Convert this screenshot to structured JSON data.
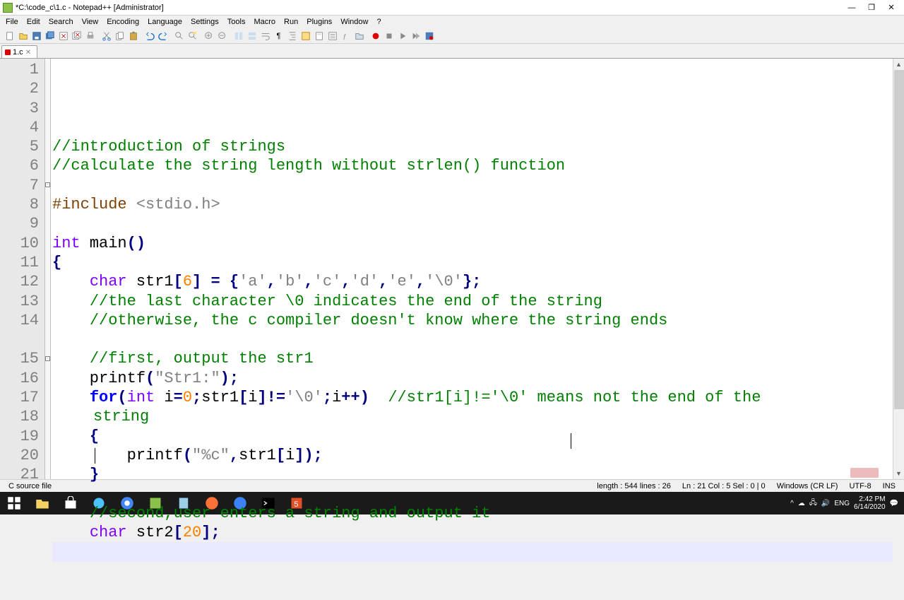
{
  "window": {
    "title": "*C:\\code_c\\1.c - Notepad++ [Administrator]"
  },
  "menu": [
    "File",
    "Edit",
    "Search",
    "View",
    "Encoding",
    "Language",
    "Settings",
    "Tools",
    "Macro",
    "Run",
    "Plugins",
    "Window",
    "?"
  ],
  "tab": {
    "label": "1.c"
  },
  "code": {
    "lines": [
      {
        "n": 1,
        "seg": [
          {
            "c": "cm",
            "t": "//introduction of strings"
          }
        ]
      },
      {
        "n": 2,
        "seg": [
          {
            "c": "cm",
            "t": "//calculate the string length without strlen() function"
          }
        ]
      },
      {
        "n": 3,
        "seg": []
      },
      {
        "n": 4,
        "seg": [
          {
            "c": "pp",
            "t": "#include "
          },
          {
            "c": "st",
            "t": "<stdio.h>"
          }
        ]
      },
      {
        "n": 5,
        "seg": []
      },
      {
        "n": 6,
        "seg": [
          {
            "c": "ty",
            "t": "int"
          },
          {
            "c": "",
            "t": " main"
          },
          {
            "c": "op",
            "t": "()"
          }
        ]
      },
      {
        "n": 7,
        "seg": [
          {
            "c": "op",
            "t": "{"
          }
        ],
        "fold": "-"
      },
      {
        "n": 8,
        "seg": [
          {
            "c": "",
            "t": "    "
          },
          {
            "c": "ty",
            "t": "char"
          },
          {
            "c": "",
            "t": " str1"
          },
          {
            "c": "op",
            "t": "["
          },
          {
            "c": "nu",
            "t": "6"
          },
          {
            "c": "op",
            "t": "]"
          },
          {
            "c": "",
            "t": " "
          },
          {
            "c": "op",
            "t": "="
          },
          {
            "c": "",
            "t": " "
          },
          {
            "c": "op",
            "t": "{"
          },
          {
            "c": "st",
            "t": "'a'"
          },
          {
            "c": "op",
            "t": ","
          },
          {
            "c": "st",
            "t": "'b'"
          },
          {
            "c": "op",
            "t": ","
          },
          {
            "c": "st",
            "t": "'c'"
          },
          {
            "c": "op",
            "t": ","
          },
          {
            "c": "st",
            "t": "'d'"
          },
          {
            "c": "op",
            "t": ","
          },
          {
            "c": "st",
            "t": "'e'"
          },
          {
            "c": "op",
            "t": ","
          },
          {
            "c": "st",
            "t": "'\\0'"
          },
          {
            "c": "op",
            "t": "};"
          }
        ]
      },
      {
        "n": 9,
        "seg": [
          {
            "c": "",
            "t": "    "
          },
          {
            "c": "cm",
            "t": "//the last character \\0 indicates the end of the string"
          }
        ]
      },
      {
        "n": 10,
        "seg": [
          {
            "c": "",
            "t": "    "
          },
          {
            "c": "cm",
            "t": "//otherwise, the c compiler doesn't know where the string ends"
          }
        ]
      },
      {
        "n": 11,
        "seg": []
      },
      {
        "n": 12,
        "seg": [
          {
            "c": "",
            "t": "    "
          },
          {
            "c": "cm",
            "t": "//first, output the str1"
          }
        ]
      },
      {
        "n": 13,
        "seg": [
          {
            "c": "",
            "t": "    printf"
          },
          {
            "c": "op",
            "t": "("
          },
          {
            "c": "st",
            "t": "\"Str1:\""
          },
          {
            "c": "op",
            "t": ");"
          }
        ]
      },
      {
        "n": 14,
        "seg": [
          {
            "c": "",
            "t": "    "
          },
          {
            "c": "kw",
            "t": "for"
          },
          {
            "c": "op",
            "t": "("
          },
          {
            "c": "ty",
            "t": "int"
          },
          {
            "c": "",
            "t": " i"
          },
          {
            "c": "op",
            "t": "="
          },
          {
            "c": "nu",
            "t": "0"
          },
          {
            "c": "op",
            "t": ";"
          },
          {
            "c": "",
            "t": "str1"
          },
          {
            "c": "op",
            "t": "["
          },
          {
            "c": "",
            "t": "i"
          },
          {
            "c": "op",
            "t": "]!="
          },
          {
            "c": "st",
            "t": "'\\0'"
          },
          {
            "c": "op",
            "t": ";"
          },
          {
            "c": "",
            "t": "i"
          },
          {
            "c": "op",
            "t": "++)"
          },
          {
            "c": "",
            "t": "  "
          },
          {
            "c": "cm",
            "t": "//str1[i]!='\\0' means not the end of the "
          }
        ]
      },
      {
        "n": 0,
        "wrap": true,
        "seg": [
          {
            "c": "cm",
            "t": "string"
          }
        ]
      },
      {
        "n": 15,
        "seg": [
          {
            "c": "",
            "t": "    "
          },
          {
            "c": "op",
            "t": "{"
          }
        ],
        "fold": "-"
      },
      {
        "n": 16,
        "seg": [
          {
            "c": "",
            "t": "        printf"
          },
          {
            "c": "op",
            "t": "("
          },
          {
            "c": "st",
            "t": "\"%c\""
          },
          {
            "c": "op",
            "t": ","
          },
          {
            "c": "",
            "t": "str1"
          },
          {
            "c": "op",
            "t": "["
          },
          {
            "c": "",
            "t": "i"
          },
          {
            "c": "op",
            "t": "]);"
          }
        ]
      },
      {
        "n": 17,
        "seg": [
          {
            "c": "",
            "t": "    "
          },
          {
            "c": "op",
            "t": "}"
          }
        ]
      },
      {
        "n": 18,
        "seg": []
      },
      {
        "n": 19,
        "seg": [
          {
            "c": "",
            "t": "    "
          },
          {
            "c": "cm",
            "t": "//second,user enters a string and output it"
          }
        ]
      },
      {
        "n": 20,
        "seg": [
          {
            "c": "",
            "t": "    "
          },
          {
            "c": "ty",
            "t": "char"
          },
          {
            "c": "",
            "t": " str2"
          },
          {
            "c": "op",
            "t": "["
          },
          {
            "c": "nu",
            "t": "20"
          },
          {
            "c": "op",
            "t": "];"
          }
        ]
      },
      {
        "n": 21,
        "seg": [
          {
            "c": "",
            "t": "    "
          }
        ],
        "current": true
      }
    ]
  },
  "status": {
    "left": "C source file",
    "length": "length : 544    lines : 26",
    "pos": "Ln : 21    Col : 5    Sel : 0 | 0",
    "eol": "Windows (CR LF)",
    "enc": "UTF-8",
    "ins": "INS"
  },
  "tray": {
    "lang": "ENG",
    "time": "2:42 PM",
    "date": "6/14/2020"
  }
}
